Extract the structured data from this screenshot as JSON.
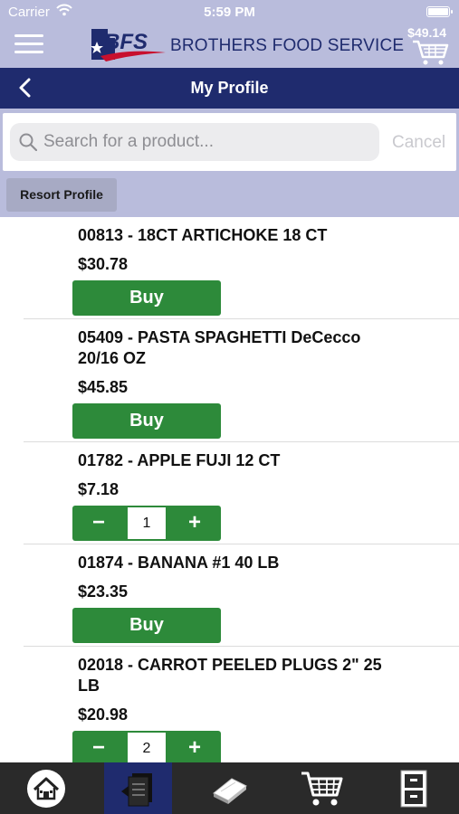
{
  "status_bar": {
    "carrier": "Carrier",
    "time": "5:59 PM"
  },
  "header": {
    "logo_text": "BFS",
    "brand_name": "BROTHERS FOOD SERVICE",
    "cart_total": "$49.14"
  },
  "titlebar": {
    "title": "My Profile"
  },
  "search": {
    "placeholder": "Search for a product...",
    "cancel_label": "Cancel"
  },
  "resort_label": "Resort Profile",
  "buy_label": "Buy",
  "stepper": {
    "minus": "−",
    "plus": "+"
  },
  "products": [
    {
      "name": "00813 - 18CT ARTICHOKE 18 CT",
      "price": "$30.78"
    },
    {
      "name": "05409 - PASTA SPAGHETTI DeCecco 20/16 OZ",
      "price": "$45.85"
    },
    {
      "name": "01782 - APPLE FUJI 12 CT",
      "price": "$7.18",
      "quantity": "1"
    },
    {
      "name": "01874 - BANANA #1 40 LB",
      "price": "$23.35"
    },
    {
      "name": "02018 - CARROT PEELED PLUGS 2\" 25 LB",
      "price": "$20.98",
      "quantity": "2"
    }
  ],
  "colors": {
    "header_bg": "#b9bcdc",
    "navy": "#1f2b6e",
    "buy_green": "#2d8a3a",
    "tabbar_bg": "#2a2a2a"
  },
  "tabs": [
    {
      "icon": "home-icon",
      "active": false
    },
    {
      "icon": "order-list-icon",
      "active": true
    },
    {
      "icon": "catalog-book-icon",
      "active": false
    },
    {
      "icon": "cart-icon",
      "active": false
    },
    {
      "icon": "file-cabinet-icon",
      "active": false
    }
  ]
}
